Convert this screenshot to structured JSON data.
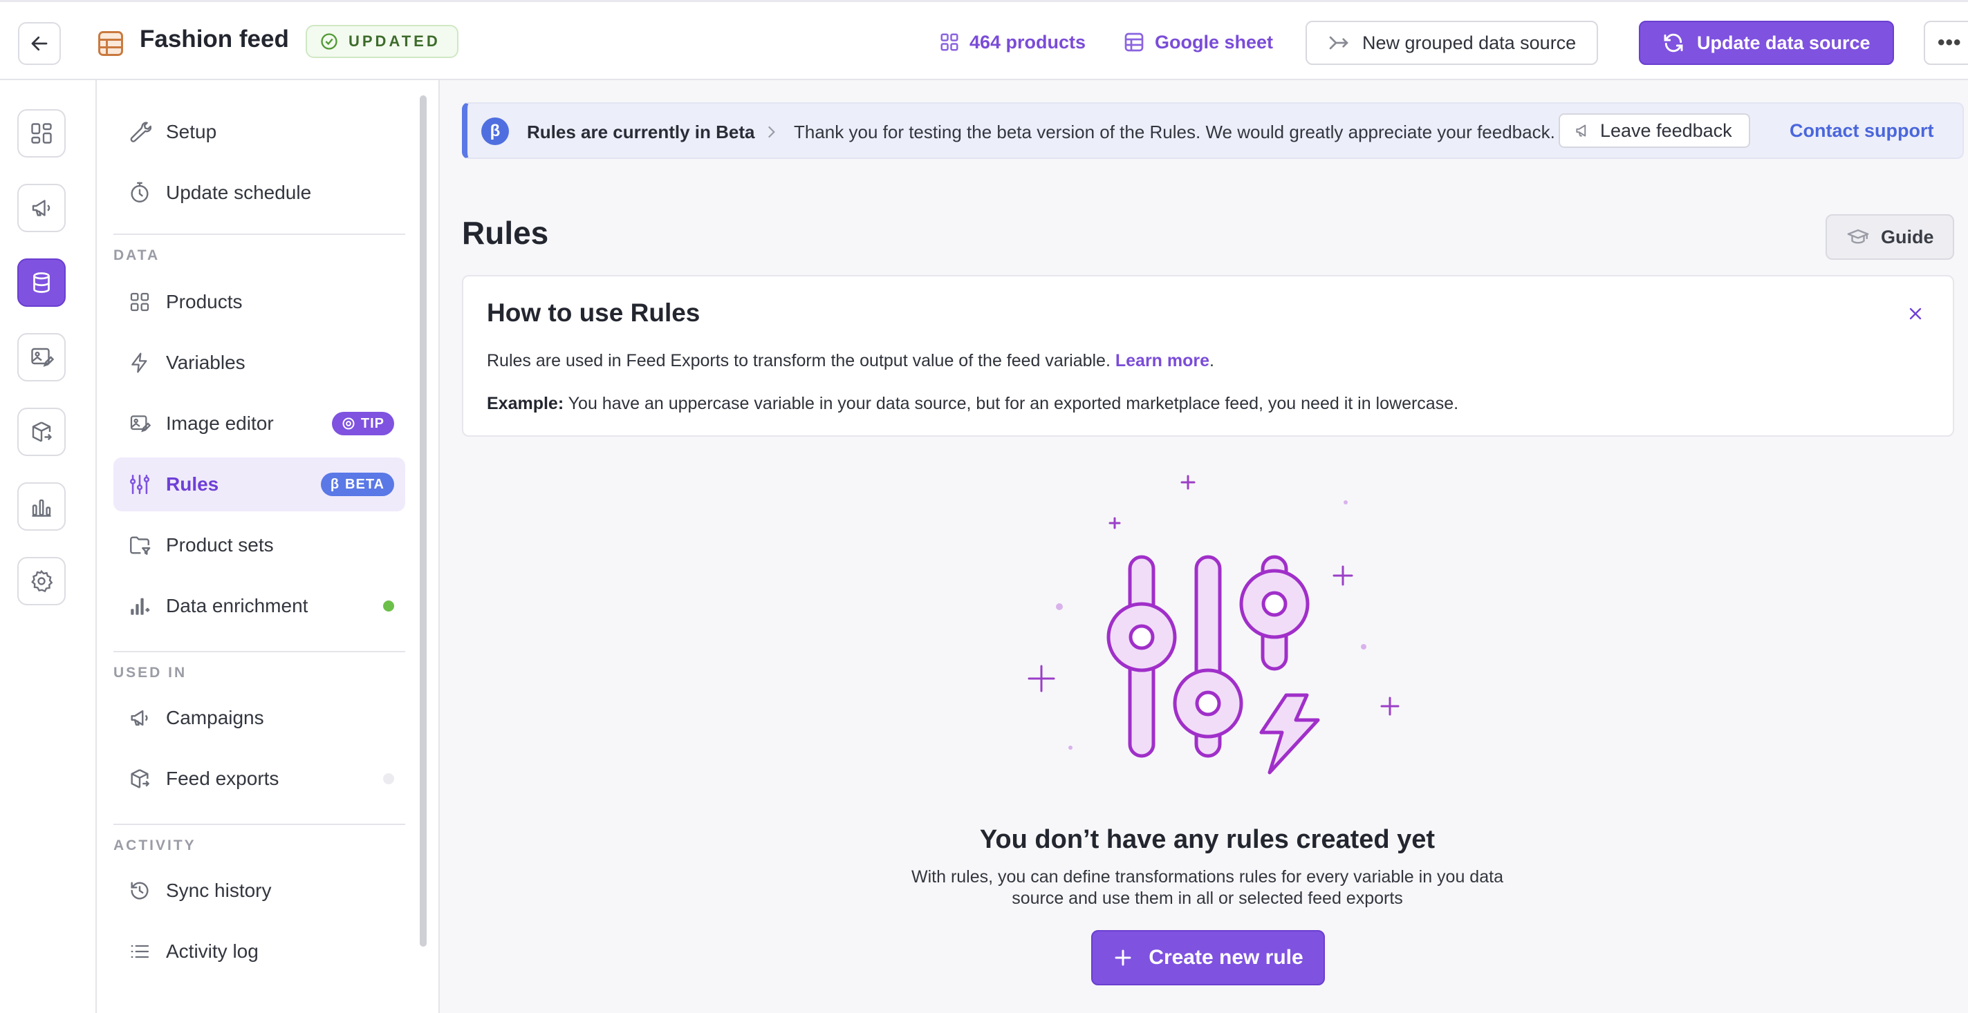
{
  "header": {
    "back_icon": "arrow-left-icon",
    "feed_icon": "spreadsheet-icon",
    "title": "Fashion feed",
    "status_badge": "UPDATED",
    "products_link": "464 products",
    "source_link": "Google sheet",
    "grouped_button": "New grouped data source",
    "update_button": "Update data source",
    "more_button": "•••"
  },
  "rail": {
    "items": [
      "dashboard-icon",
      "megaphone-icon",
      "database-icon",
      "image-edit-icon",
      "box-export-icon",
      "bar-chart-icon",
      "gear-icon"
    ],
    "active_index": 2
  },
  "nav": {
    "items_top": [
      {
        "label": "Setup",
        "icon": "wrench-icon"
      },
      {
        "label": "Update schedule",
        "icon": "stopwatch-icon"
      }
    ],
    "section_data": "DATA",
    "items_data": [
      {
        "label": "Products",
        "icon": "grid-icon"
      },
      {
        "label": "Variables",
        "icon": "lightning-icon"
      },
      {
        "label": "Image editor",
        "icon": "image-edit-icon",
        "badge": "TIP"
      },
      {
        "label": "Rules",
        "icon": "sliders-icon",
        "badge": "BETA",
        "badge_prefix": "β",
        "active": true
      },
      {
        "label": "Product sets",
        "icon": "folder-filter-icon"
      },
      {
        "label": "Data enrichment",
        "icon": "chart-plus-icon",
        "status": "green"
      }
    ],
    "section_used_in": "USED IN",
    "items_used_in": [
      {
        "label": "Campaigns",
        "icon": "megaphone-icon"
      },
      {
        "label": "Feed exports",
        "icon": "box-export-icon",
        "status": "gray"
      }
    ],
    "section_activity": "ACTIVITY",
    "items_activity": [
      {
        "label": "Sync history",
        "icon": "history-icon"
      },
      {
        "label": "Activity log",
        "icon": "list-icon"
      }
    ]
  },
  "beta_banner": {
    "badge": "β",
    "title": "Rules are currently in Beta",
    "message": "Thank you for testing the beta version of the Rules. We would greatly appreciate your feedback.",
    "feedback_button": "Leave feedback",
    "support_link": "Contact support"
  },
  "page": {
    "title": "Rules",
    "guide_button": "Guide"
  },
  "info_card": {
    "title": "How to use Rules",
    "line1": "Rules are used in Feed Exports to transform the output value of the feed variable.",
    "learn_more": "Learn more",
    "line1_end": ".",
    "example_label": "Example:",
    "example_text": "You have an uppercase variable in your data source, but for an exported marketplace feed, you need it in lowercase."
  },
  "empty_state": {
    "title": "You don’t have any rules created yet",
    "description": "With rules, you can define transformations rules for every variable in you data source and use them in all or selected feed exports",
    "create_button": "Create new rule"
  },
  "colors": {
    "primary": "#7f52e0",
    "accent_blue": "#4f6fe0",
    "success": "#6cc04a",
    "text": "#23262f"
  }
}
